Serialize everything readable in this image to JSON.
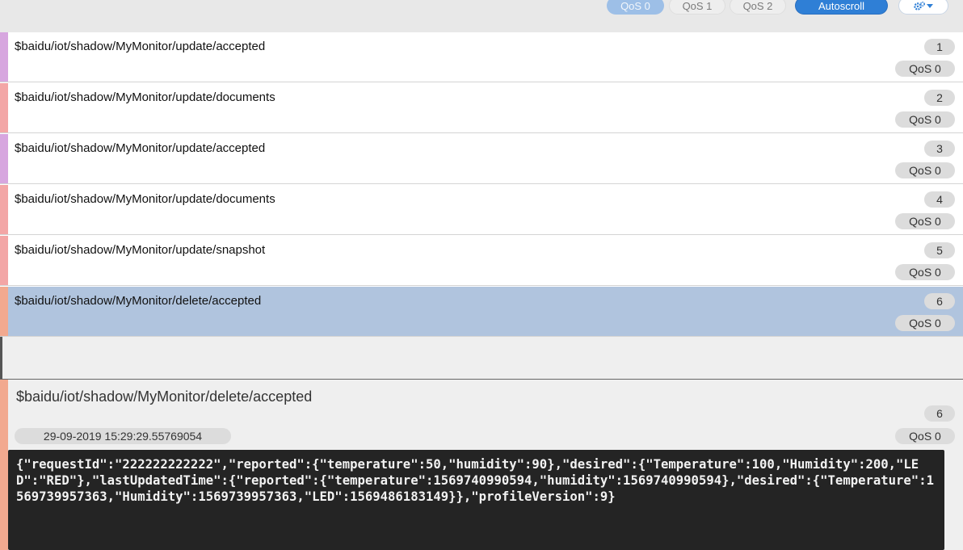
{
  "toolbar": {
    "qos_buttons": [
      {
        "label": "QoS 0",
        "active": true
      },
      {
        "label": "QoS 1",
        "active": false
      },
      {
        "label": "QoS 2",
        "active": false
      }
    ],
    "autoscroll_label": "Autoscroll",
    "settings_icon": "gears-icon",
    "dropdown_icon": "caret-down-icon"
  },
  "messages": [
    {
      "topic": "$baidu/iot/shadow/MyMonitor/update/accepted",
      "index": "1",
      "qos": "QoS 0",
      "color": "#d7a6df"
    },
    {
      "topic": "$baidu/iot/shadow/MyMonitor/update/documents",
      "index": "2",
      "qos": "QoS 0",
      "color": "#f3a6a6"
    },
    {
      "topic": "$baidu/iot/shadow/MyMonitor/update/accepted",
      "index": "3",
      "qos": "QoS 0",
      "color": "#d7a6df"
    },
    {
      "topic": "$baidu/iot/shadow/MyMonitor/update/documents",
      "index": "4",
      "qos": "QoS 0",
      "color": "#f3a6a6"
    },
    {
      "topic": "$baidu/iot/shadow/MyMonitor/update/snapshot",
      "index": "5",
      "qos": "QoS 0",
      "color": "#f3a6a6"
    },
    {
      "topic": "$baidu/iot/shadow/MyMonitor/delete/accepted",
      "index": "6",
      "qos": "QoS 0",
      "color": "#f2a98f",
      "selected": true
    }
  ],
  "detail": {
    "topic": "$baidu/iot/shadow/MyMonitor/delete/accepted",
    "index": "6",
    "timestamp": "29-09-2019  15:29:29.55769054",
    "qos": "QoS 0",
    "payload": "{\"requestId\":\"222222222222\",\"reported\":{\"temperature\":50,\"humidity\":90},\"desired\":{\"Temperature\":100,\"Humidity\":200,\"LED\":\"RED\"},\"lastUpdatedTime\":{\"reported\":{\"temperature\":1569740990594,\"humidity\":1569740990594},\"desired\":{\"Temperature\":1569739957363,\"Humidity\":1569739957363,\"LED\":1569486183149}},\"profileVersion\":9}"
  },
  "colors": {
    "selected_row": "#b0c4de",
    "autoscroll": "#2f7fd6",
    "payload_background": "#242424"
  }
}
